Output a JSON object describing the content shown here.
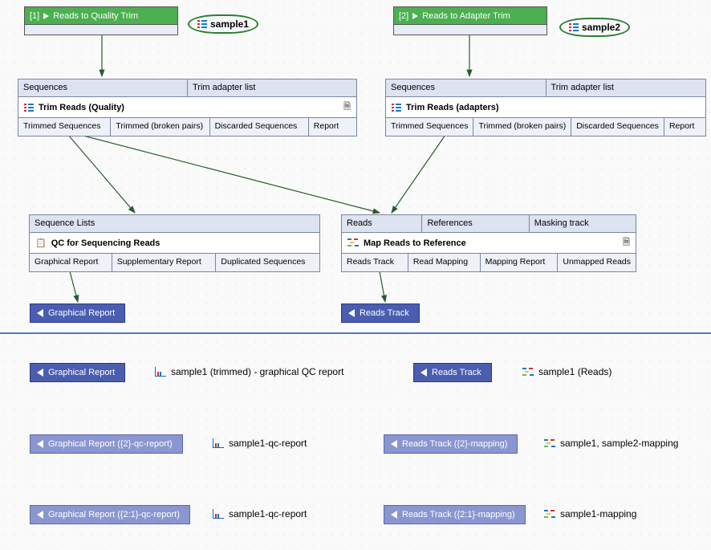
{
  "colors": {
    "green": "#4caf50",
    "blue_chip": "#4a5db0",
    "blue_chip_light": "#8a96d0",
    "panel_header": "#dde3f0"
  },
  "inputs": {
    "n1": {
      "num": "[1]",
      "label": "Reads to Quality Trim",
      "sample": "sample1"
    },
    "n2": {
      "num": "[2]",
      "label": "Reads to Adapter Trim",
      "sample": "sample2"
    }
  },
  "trim_q": {
    "in1": "Sequences",
    "in2": "Trim adapter list",
    "title": "Trim Reads (Quality)",
    "out1": "Trimmed Sequences",
    "out2": "Trimmed (broken pairs)",
    "out3": "Discarded Sequences",
    "out4": "Report"
  },
  "trim_a": {
    "in1": "Sequences",
    "in2": "Trim adapter list",
    "title": "Trim Reads (adapters)",
    "out1": "Trimmed Sequences",
    "out2": "Trimmed (broken pairs)",
    "out3": "Discarded Sequences",
    "out4": "Report"
  },
  "qc": {
    "in1": "Sequence Lists",
    "title": "QC for Sequencing Reads",
    "out1": "Graphical Report",
    "out2": "Supplementary Report",
    "out3": "Duplicated Sequences"
  },
  "map": {
    "in1": "Reads",
    "in2": "References",
    "in3": "Masking track",
    "title": "Map Reads to Reference",
    "out1": "Reads Track",
    "out2": "Read Mapping",
    "out3": "Mapping Report",
    "out4": "Unmapped Reads"
  },
  "chips": {
    "gr": "Graphical Report",
    "rt": "Reads Track",
    "gr2": "Graphical Report ({2}-qc-report)",
    "gr21": "Graphical Report ({2:1}-qc-report)",
    "rt2": "Reads Track ({2}-mapping)",
    "rt21": "Reads Track ({2:1}-mapping)"
  },
  "results": {
    "r1": "sample1 (trimmed) - graphical QC report",
    "r2": "sample1 (Reads)",
    "r3": "sample1-qc-report",
    "r4": "sample1, sample2-mapping",
    "r5": "sample1-qc-report",
    "r6": "sample1-mapping"
  }
}
